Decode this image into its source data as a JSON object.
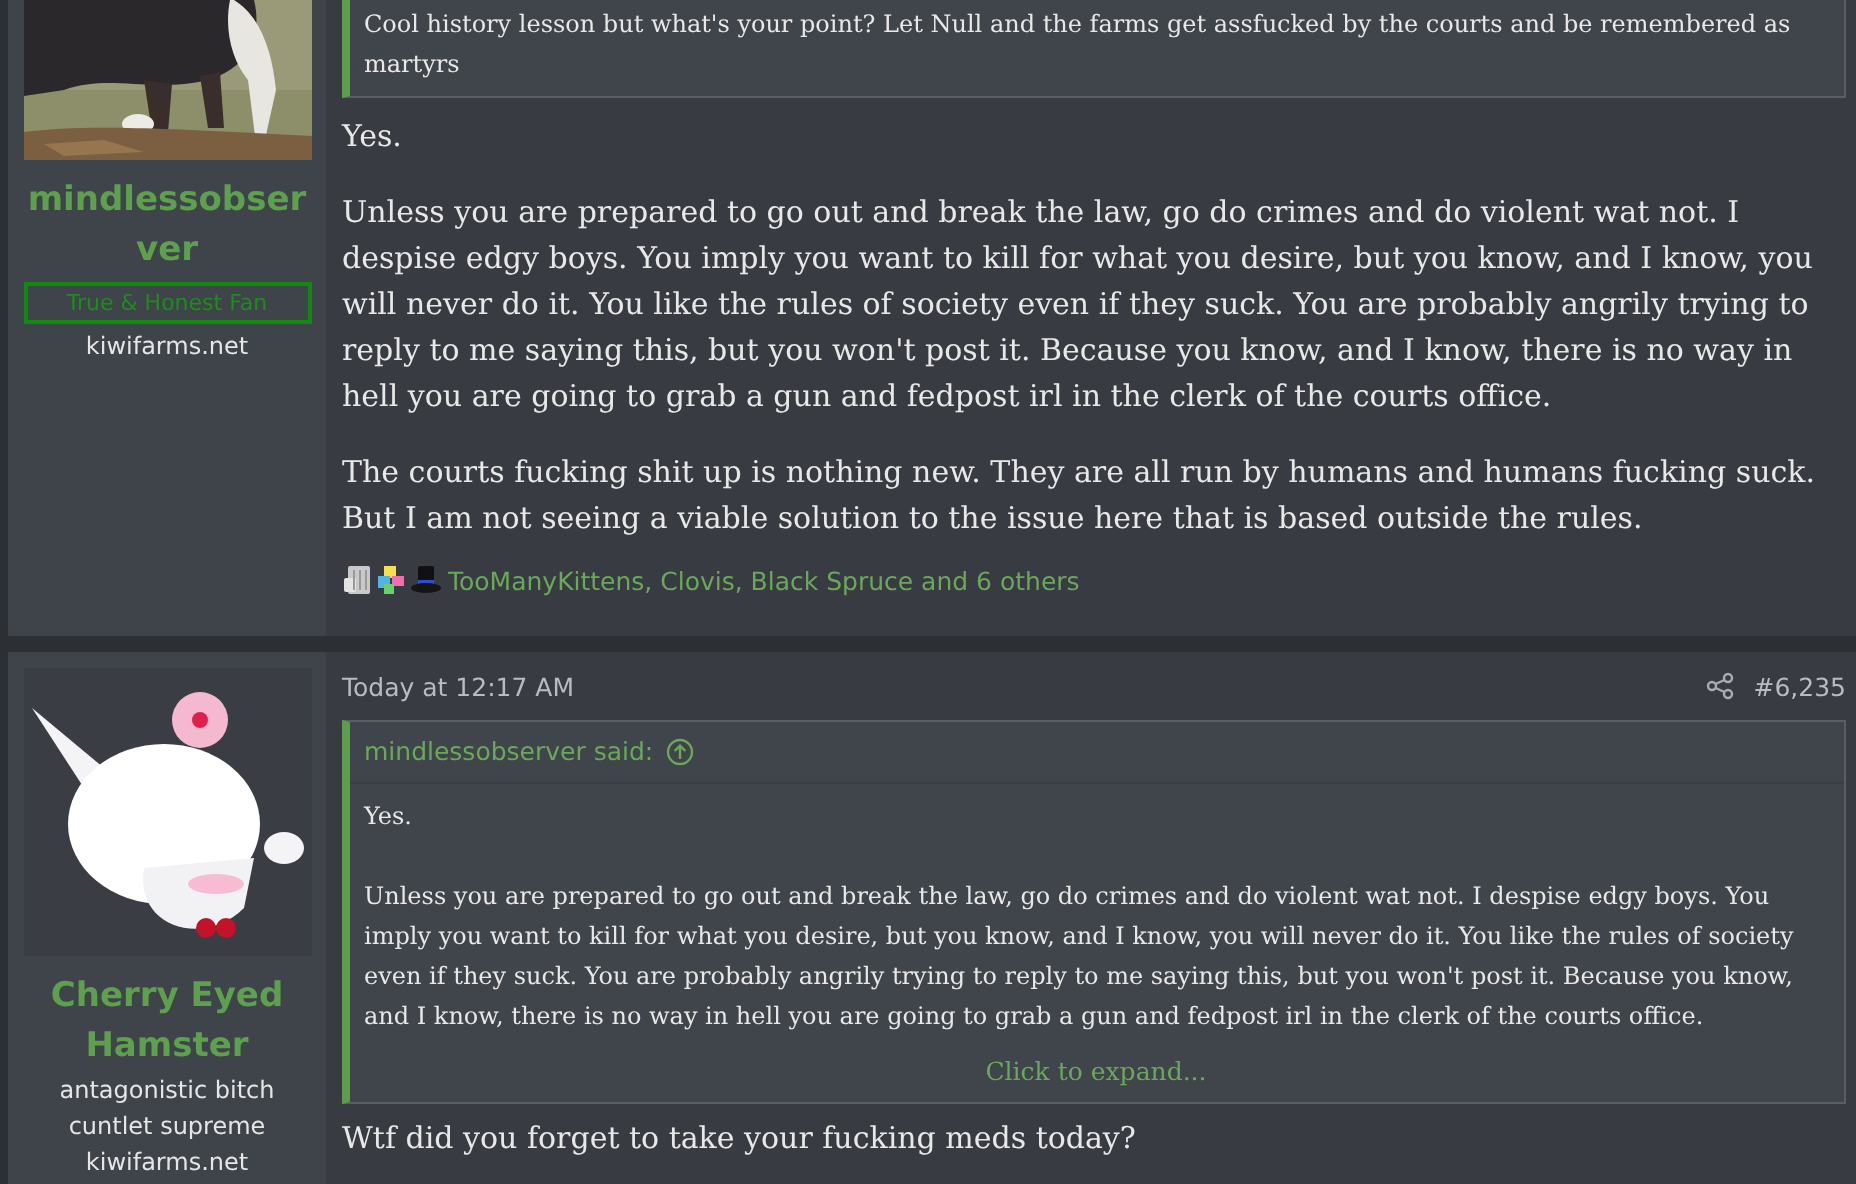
{
  "posts": [
    {
      "author": {
        "name": "mindlessobserver",
        "banner": "True & Honest Fan",
        "extras": [
          "kiwifarms.net"
        ]
      },
      "quote": {
        "paragraphs": [
          "Cool history lesson but what's your point? Let Null and the farms get assfucked by the courts and be remembered as martyrs"
        ]
      },
      "paragraphs": [
        "Yes.",
        "Unless you are prepared to go out and break the law, go do crimes and do violent wat not. I despise edgy boys. You imply you want to kill for what you desire, but you know, and I know, you will never do it. You like the rules of society even if they suck. You are probably angrily trying to reply to me saying this, but you won't post it. Because you know, and I know, there is no way in hell you are going to grab a gun and fedpost irl in the clerk of the courts office.",
        "The courts fucking shit up is nothing new. They are all run by humans and humans fucking suck. But I am not seeing a viable solution to the issue here that is based outside the rules."
      ],
      "reactions": "TooManyKittens, Clovis, Black Spruce and 6 others"
    },
    {
      "author": {
        "name": "Cherry Eyed Hamster",
        "extras": [
          "antagonistic bitch cuntlet supreme",
          "kiwifarms.net"
        ]
      },
      "date": "Today at 12:17 AM",
      "number": "#6,235",
      "quote": {
        "attribution": "mindlessobserver said:",
        "paragraphs": [
          "Yes.",
          "Unless you are prepared to go out and break the law, go do crimes and do violent wat not. I despise edgy boys. You imply you want to kill for what you desire, but you know, and I know, you will never do it. You like the rules of society even if they suck. You are probably angrily trying to reply to me saying this, but you won't post it. Because you know, and I know, there is no way in hell you are going to grab a gun and fedpost irl in the clerk of the courts office."
        ],
        "expand": "Click to expand..."
      },
      "paragraphs": [
        "Wtf did you forget to take your fucking meds today?"
      ]
    }
  ]
}
